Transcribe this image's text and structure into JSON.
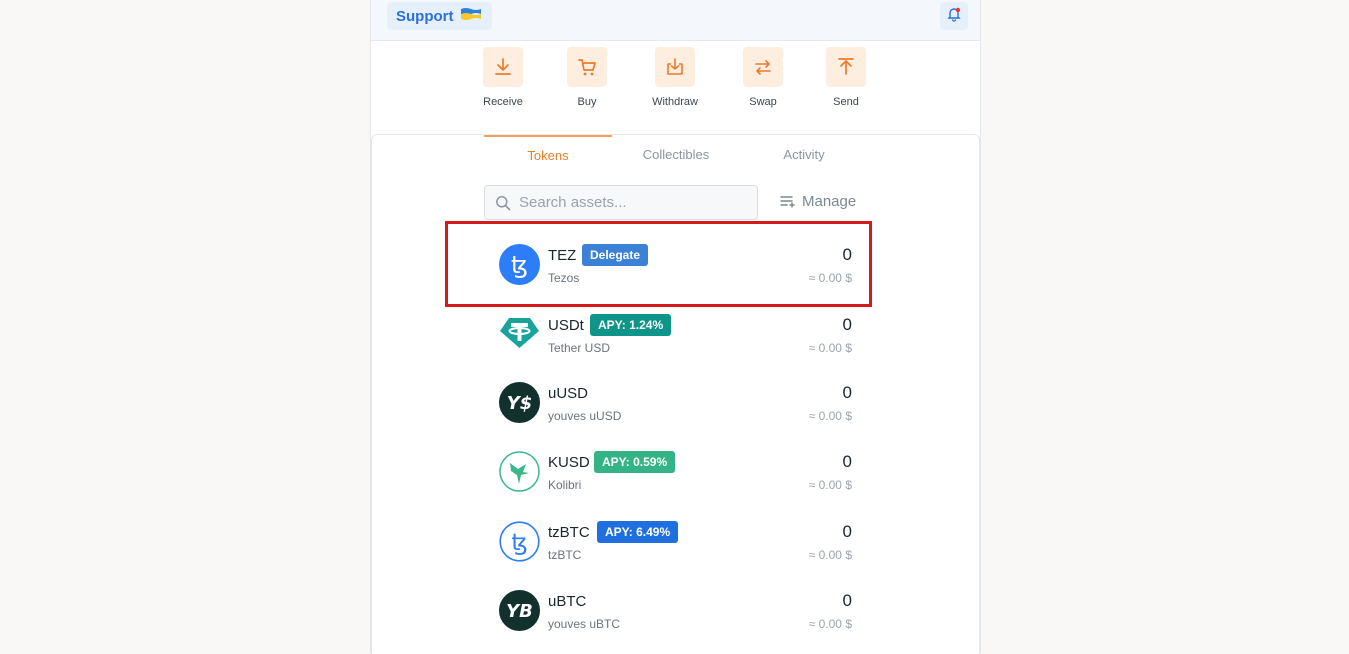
{
  "header": {
    "support_label": "Support"
  },
  "actions": [
    {
      "label": "Receive",
      "icon": "download-icon"
    },
    {
      "label": "Buy",
      "icon": "cart-icon"
    },
    {
      "label": "Withdraw",
      "icon": "withdraw-icon"
    },
    {
      "label": "Swap",
      "icon": "swap-icon"
    },
    {
      "label": "Send",
      "icon": "upload-icon"
    }
  ],
  "tabs": [
    {
      "label": "Tokens",
      "active": true
    },
    {
      "label": "Collectibles",
      "active": false
    },
    {
      "label": "Activity",
      "active": false
    }
  ],
  "search": {
    "placeholder": "Search assets..."
  },
  "manage_label": "Manage",
  "tokens": [
    {
      "symbol": "TEZ",
      "name": "Tezos",
      "badge": "Delegate",
      "badge_color": "#3b82d6",
      "balance": "0",
      "fiat": "≈ 0.00 $"
    },
    {
      "symbol": "USDt",
      "name": "Tether USD",
      "badge": "APY: 1.24%",
      "badge_color": "#0e9488",
      "balance": "0",
      "fiat": "≈ 0.00 $"
    },
    {
      "symbol": "uUSD",
      "name": "youves uUSD",
      "badge": "",
      "badge_color": "",
      "balance": "0",
      "fiat": "≈ 0.00 $"
    },
    {
      "symbol": "KUSD",
      "name": "Kolibri",
      "badge": "APY: 0.59%",
      "badge_color": "#34b386",
      "balance": "0",
      "fiat": "≈ 0.00 $"
    },
    {
      "symbol": "tzBTC",
      "name": "tzBTC",
      "badge": "APY: 6.49%",
      "badge_color": "#1f6fe0",
      "balance": "0",
      "fiat": "≈ 0.00 $"
    },
    {
      "symbol": "uBTC",
      "name": "youves uBTC",
      "badge": "",
      "badge_color": "",
      "balance": "0",
      "fiat": "≈ 0.00 $"
    }
  ],
  "colors": {
    "accent": "#e8802a",
    "highlight": "#d41a1a"
  }
}
